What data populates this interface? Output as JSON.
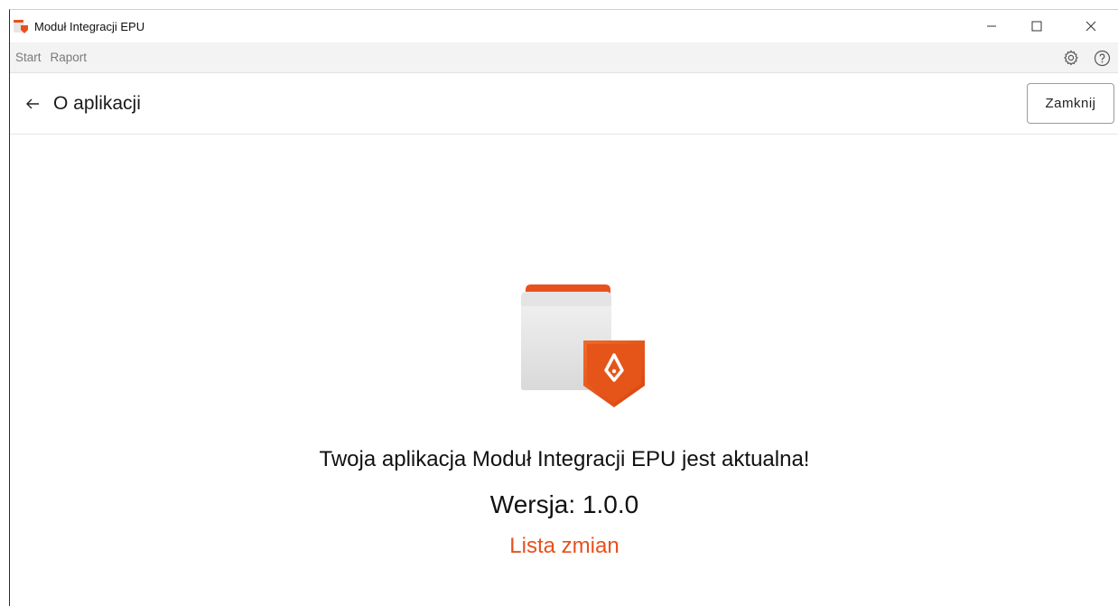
{
  "window": {
    "title": "Moduł Integracji EPU",
    "minimize_glyph": "—",
    "maximize_glyph": "☐",
    "close_glyph": "✕"
  },
  "menu": {
    "items": [
      {
        "label": "Start"
      },
      {
        "label": "Raport"
      }
    ],
    "settings_icon": "gear-icon",
    "help_icon": "question-circle-icon"
  },
  "header": {
    "back_icon": "arrow-left-icon",
    "title": "O aplikacji",
    "close_label": "Zamknij"
  },
  "main": {
    "status_text": "Twoja aplikacja Moduł Integracji EPU jest aktualna!",
    "version_label": "Wersja:",
    "version_value": "1.0.0",
    "changelog_label": "Lista zmian"
  },
  "colors": {
    "accent": "#e8501c",
    "accent_dark": "#c83c10",
    "menu_bg": "#f3f3f3"
  }
}
